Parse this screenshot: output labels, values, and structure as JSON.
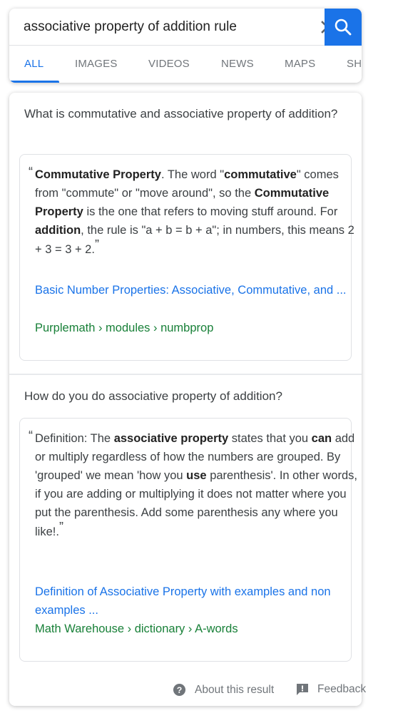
{
  "search": {
    "query": "associative property of addition rule",
    "clear_icon": "close-icon",
    "search_icon": "search-icon"
  },
  "tabs": [
    {
      "label": "ALL",
      "active": true
    },
    {
      "label": "IMAGES",
      "active": false
    },
    {
      "label": "VIDEOS",
      "active": false
    },
    {
      "label": "NEWS",
      "active": false
    },
    {
      "label": "MAPS",
      "active": false
    },
    {
      "label": "SHOPPING",
      "active": false
    }
  ],
  "questions": [
    {
      "question": "What is commutative and associative property of addition?",
      "answer_segments": [
        {
          "text": "Commutative Property",
          "bold": true
        },
        {
          "text": ". The word \"",
          "bold": false
        },
        {
          "text": "commutative",
          "bold": true
        },
        {
          "text": "\" comes from \"commute\" or \"move around\", so the ",
          "bold": false
        },
        {
          "text": "Commutative Property",
          "bold": true
        },
        {
          "text": " is the one that refers to moving stuff around. For ",
          "bold": false
        },
        {
          "text": "addition",
          "bold": true
        },
        {
          "text": ", the rule is \"a + b = b + a\"; in numbers, this means 2 + 3 = 3 + 2.",
          "bold": false
        }
      ],
      "link_title": "Basic Number Properties: Associative, Commutative, and ...",
      "source_url": "Purplemath › modules › numbprop"
    },
    {
      "question": "How do you do associative property of addition?",
      "answer_segments": [
        {
          "text": "Definition: The ",
          "bold": false
        },
        {
          "text": "associative property",
          "bold": true
        },
        {
          "text": " states that you ",
          "bold": false
        },
        {
          "text": "can",
          "bold": true
        },
        {
          "text": " add or multiply regardless of how the numbers are grouped. By 'grouped' we mean 'how you ",
          "bold": false
        },
        {
          "text": "use",
          "bold": true
        },
        {
          "text": " parenthesis'. In other words, if you are adding or multiplying it does not matter where you put the parenthesis. Add some parenthesis any where you like!.",
          "bold": false
        }
      ],
      "link_title": "Definition of Associative Property with examples and non examples ...",
      "source_url": "Math Warehouse › dictionary › A-words"
    }
  ],
  "quotes": {
    "open": "“",
    "close": "”"
  },
  "footer": {
    "about_label": "About this result",
    "about_icon": "help-circle-icon",
    "feedback_label": "Feedback",
    "feedback_icon": "feedback-icon"
  },
  "colors": {
    "accent": "#1a73e8",
    "link": "#1a73e8",
    "url_green": "#188038",
    "text": "#3c4043",
    "muted": "#70757a"
  }
}
